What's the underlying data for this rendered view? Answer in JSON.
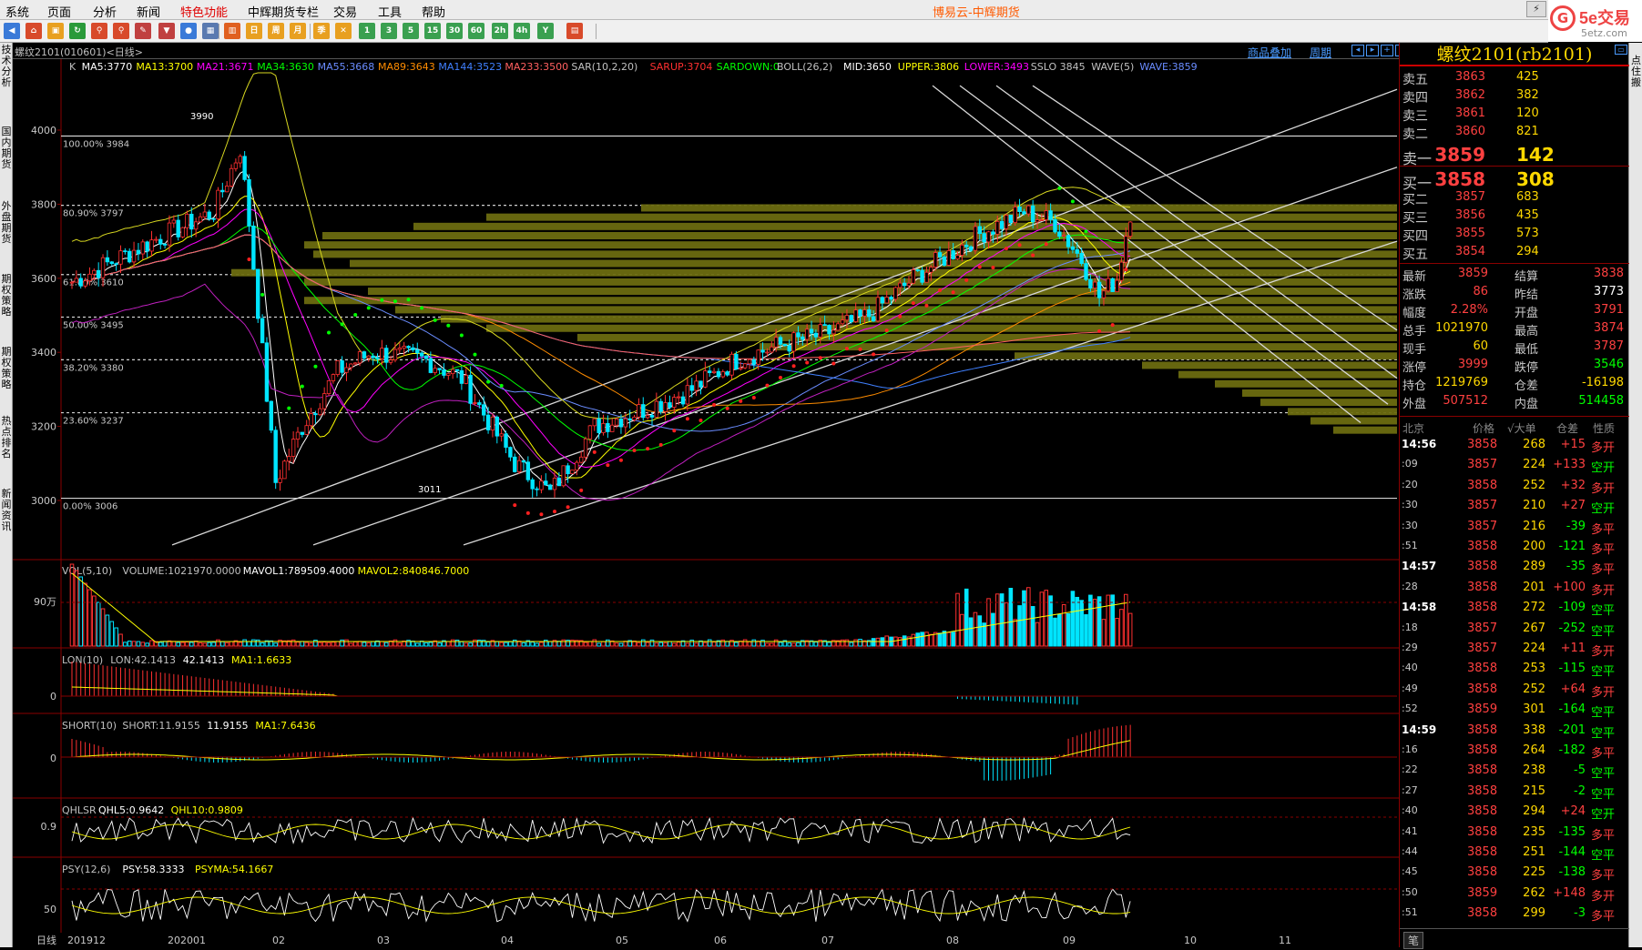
{
  "app": {
    "title": "博易云-中辉期货"
  },
  "menu": [
    "系统",
    "页面",
    "分析",
    "新闻",
    "特色功能",
    "中辉期货专栏",
    "交易",
    "工具",
    "帮助"
  ],
  "logo": {
    "mark": "G",
    "name": "5e交易",
    "url": "5etz.com"
  },
  "left_tabs": [
    "技术分析",
    "国内期货",
    "外盘期货",
    "期权策略",
    "期权策略",
    "热点排名",
    "新闻资讯"
  ],
  "right_tab": "点住搬",
  "chart": {
    "symbol": "螺纹2101(010601)<日线>",
    "links": [
      "商品叠加",
      "周期"
    ],
    "main_legend": [
      {
        "t": "K",
        "c": "#c0c0c0"
      },
      {
        "t": "MA5:3770",
        "c": "#ffffff"
      },
      {
        "t": "MA13:3700",
        "c": "#ffff00"
      },
      {
        "t": "MA21:3671",
        "c": "#ff00ff"
      },
      {
        "t": "MA34:3630",
        "c": "#00ff00"
      },
      {
        "t": "MA55:3668",
        "c": "#6a8cff"
      },
      {
        "t": "MA89:3643",
        "c": "#ff8c00"
      },
      {
        "t": "MA144:3523",
        "c": "#4080ff"
      },
      {
        "t": "MA233:3500",
        "c": "#ff6060"
      },
      {
        "t": "SAR(10,2,20)",
        "c": "#c0c0c0"
      },
      {
        "t": "SARUP:3704",
        "c": "#ff3030"
      },
      {
        "t": "SARDOWN:0",
        "c": "#00ff00"
      },
      {
        "t": "BOLL(26,2)",
        "c": "#c0c0c0"
      },
      {
        "t": "MID:3650",
        "c": "#ffffff"
      },
      {
        "t": "UPPER:3806",
        "c": "#ffff00"
      },
      {
        "t": "LOWER:3493",
        "c": "#ff00ff"
      },
      {
        "t": "SSLO 3845",
        "c": "#c0c0c0"
      },
      {
        "t": "WAVE(5)",
        "c": "#c0c0c0"
      },
      {
        "t": "WAVE:3859",
        "c": "#6a8cff"
      }
    ],
    "price_ticks": [
      "4000",
      "3800",
      "3600",
      "3400",
      "3200",
      "3000"
    ],
    "fib_levels": [
      {
        "label": "100.00% 3984",
        "price": 3984
      },
      {
        "label": "80.90% 3797",
        "price": 3797
      },
      {
        "label": "61.80% 3610",
        "price": 3610
      },
      {
        "label": "50.00% 3495",
        "price": 3495
      },
      {
        "label": "38.20% 3380",
        "price": 3380
      },
      {
        "label": "23.60% 3237",
        "price": 3237
      },
      {
        "label": "0.00% 3006",
        "price": 3006
      }
    ],
    "high_marker": "3990",
    "low_marker": "3011",
    "x_ticks": [
      "201912",
      "202001",
      "02",
      "03",
      "04",
      "05",
      "06",
      "07",
      "08",
      "09",
      "10",
      "11"
    ],
    "x_label": "日线",
    "volume": {
      "legend": [
        {
          "t": "VOL(5,10)",
          "c": "#c0c0c0"
        },
        {
          "t": "VOLUME:1021970.0000",
          "c": "#c0c0c0"
        },
        {
          "t": "MAVOL1:789509.4000",
          "c": "#ffffff"
        },
        {
          "t": "MAVOL2:840846.7000",
          "c": "#ffff00"
        }
      ],
      "tick": "90万"
    },
    "lon": {
      "legend": [
        {
          "t": "LON(10)",
          "c": "#c0c0c0"
        },
        {
          "t": "LON:42.1413",
          "c": "#c0c0c0"
        },
        {
          "t": "42.1413",
          "c": "#ffffff"
        },
        {
          "t": "MA1:1.6633",
          "c": "#ffff00"
        }
      ],
      "tick": "0"
    },
    "short": {
      "legend": [
        {
          "t": "SHORT(10)",
          "c": "#c0c0c0"
        },
        {
          "t": "SHORT:11.9155",
          "c": "#c0c0c0"
        },
        {
          "t": "11.9155",
          "c": "#ffffff"
        },
        {
          "t": "MA1:7.6436",
          "c": "#ffff00"
        }
      ],
      "tick": "0"
    },
    "qhlsr": {
      "legend": [
        {
          "t": "QHLSR",
          "c": "#c0c0c0"
        },
        {
          "t": "QHL5:0.9642",
          "c": "#ffffff"
        },
        {
          "t": "QHL10:0.9809",
          "c": "#ffff00"
        }
      ],
      "tick": "0.9"
    },
    "psy": {
      "legend": [
        {
          "t": "PSY(12,6)",
          "c": "#c0c0c0"
        },
        {
          "t": "PSY:58.3333",
          "c": "#ffffff"
        },
        {
          "t": "PSYMA:54.1667",
          "c": "#ffff00"
        }
      ],
      "tick": "50"
    }
  },
  "quote": {
    "title": "螺纹2101(rb2101)",
    "asks": [
      {
        "l": "卖五",
        "p": "3863",
        "v": "425"
      },
      {
        "l": "卖四",
        "p": "3862",
        "v": "382"
      },
      {
        "l": "卖三",
        "p": "3861",
        "v": "120"
      },
      {
        "l": "卖二",
        "p": "3860",
        "v": "821"
      },
      {
        "l": "卖一",
        "p": "3859",
        "v": "142"
      }
    ],
    "bids": [
      {
        "l": "买一",
        "p": "3858",
        "v": "308"
      },
      {
        "l": "买二",
        "p": "3857",
        "v": "683"
      },
      {
        "l": "买三",
        "p": "3856",
        "v": "435"
      },
      {
        "l": "买四",
        "p": "3855",
        "v": "573"
      },
      {
        "l": "买五",
        "p": "3854",
        "v": "294"
      }
    ],
    "stats": [
      {
        "a": "最新",
        "b": "3859",
        "bc": "#ff4040",
        "c": "结算",
        "d": "3838",
        "dc": "#ff4040"
      },
      {
        "a": "涨跌",
        "b": "86",
        "bc": "#ff4040",
        "c": "昨结",
        "d": "3773",
        "dc": "#ffffff"
      },
      {
        "a": "幅度",
        "b": "2.28%",
        "bc": "#ff4040",
        "c": "开盘",
        "d": "3791",
        "dc": "#ff4040"
      },
      {
        "a": "总手",
        "b": "1021970",
        "bc": "#ffd800",
        "c": "最高",
        "d": "3874",
        "dc": "#ff4040"
      },
      {
        "a": "现手",
        "b": "60",
        "bc": "#ffd800",
        "c": "最低",
        "d": "3787",
        "dc": "#ff4040"
      },
      {
        "a": "涨停",
        "b": "3999",
        "bc": "#ff4040",
        "c": "跌停",
        "d": "3546",
        "dc": "#00ff00"
      },
      {
        "a": "持仓",
        "b": "1219769",
        "bc": "#ffd800",
        "c": "仓差",
        "d": "-16198",
        "dc": "#ffd800"
      },
      {
        "a": "外盘",
        "b": "507512",
        "bc": "#ff4040",
        "c": "内盘",
        "d": "514458",
        "dc": "#00ff00"
      }
    ],
    "ticks_header": [
      "北京",
      "价格",
      "√大单",
      "仓差",
      "性质"
    ],
    "ticks": [
      {
        "t": "14:56",
        "b": true,
        "p": "3858",
        "v": "268",
        "d": "+15",
        "k": "多开"
      },
      {
        "t": ":09",
        "p": "3857",
        "v": "224",
        "d": "+133",
        "k": "空开"
      },
      {
        "t": ":20",
        "p": "3858",
        "v": "252",
        "d": "+32",
        "k": "多开"
      },
      {
        "t": ":30",
        "p": "3857",
        "v": "210",
        "d": "+27",
        "k": "空开"
      },
      {
        "t": ":30",
        "p": "3857",
        "v": "216",
        "d": "-39",
        "k": "多平"
      },
      {
        "t": ":51",
        "p": "3858",
        "v": "200",
        "d": "-121",
        "k": "多平"
      },
      {
        "t": "14:57",
        "b": true,
        "p": "3858",
        "v": "289",
        "d": "-35",
        "k": "多平"
      },
      {
        "t": ":28",
        "p": "3858",
        "v": "201",
        "d": "+100",
        "k": "多开"
      },
      {
        "t": "14:58",
        "b": true,
        "p": "3858",
        "v": "272",
        "d": "-109",
        "k": "空平"
      },
      {
        "t": ":18",
        "p": "3857",
        "v": "267",
        "d": "-252",
        "k": "空平"
      },
      {
        "t": ":29",
        "p": "3857",
        "v": "224",
        "d": "+11",
        "k": "多开"
      },
      {
        "t": ":40",
        "p": "3858",
        "v": "253",
        "d": "-115",
        "k": "空平"
      },
      {
        "t": ":49",
        "p": "3858",
        "v": "252",
        "d": "+64",
        "k": "多开"
      },
      {
        "t": ":52",
        "p": "3859",
        "v": "301",
        "d": "-164",
        "k": "空平"
      },
      {
        "t": "14:59",
        "b": true,
        "p": "3858",
        "v": "338",
        "d": "-201",
        "k": "空平"
      },
      {
        "t": ":16",
        "p": "3858",
        "v": "264",
        "d": "-182",
        "k": "多平"
      },
      {
        "t": ":22",
        "p": "3858",
        "v": "238",
        "d": "-5",
        "k": "空平"
      },
      {
        "t": ":27",
        "p": "3858",
        "v": "215",
        "d": "-2",
        "k": "空平"
      },
      {
        "t": ":40",
        "p": "3858",
        "v": "294",
        "d": "+24",
        "k": "空开"
      },
      {
        "t": ":41",
        "p": "3858",
        "v": "235",
        "d": "-135",
        "k": "多平"
      },
      {
        "t": ":44",
        "p": "3858",
        "v": "251",
        "d": "-144",
        "k": "空平"
      },
      {
        "t": ":45",
        "p": "3858",
        "v": "225",
        "d": "-138",
        "k": "多平"
      },
      {
        "t": ":50",
        "p": "3859",
        "v": "262",
        "d": "+148",
        "k": "多开"
      },
      {
        "t": ":51",
        "p": "3858",
        "v": "299",
        "d": "-3",
        "k": "多平"
      }
    ],
    "footer_tab": "笔"
  }
}
